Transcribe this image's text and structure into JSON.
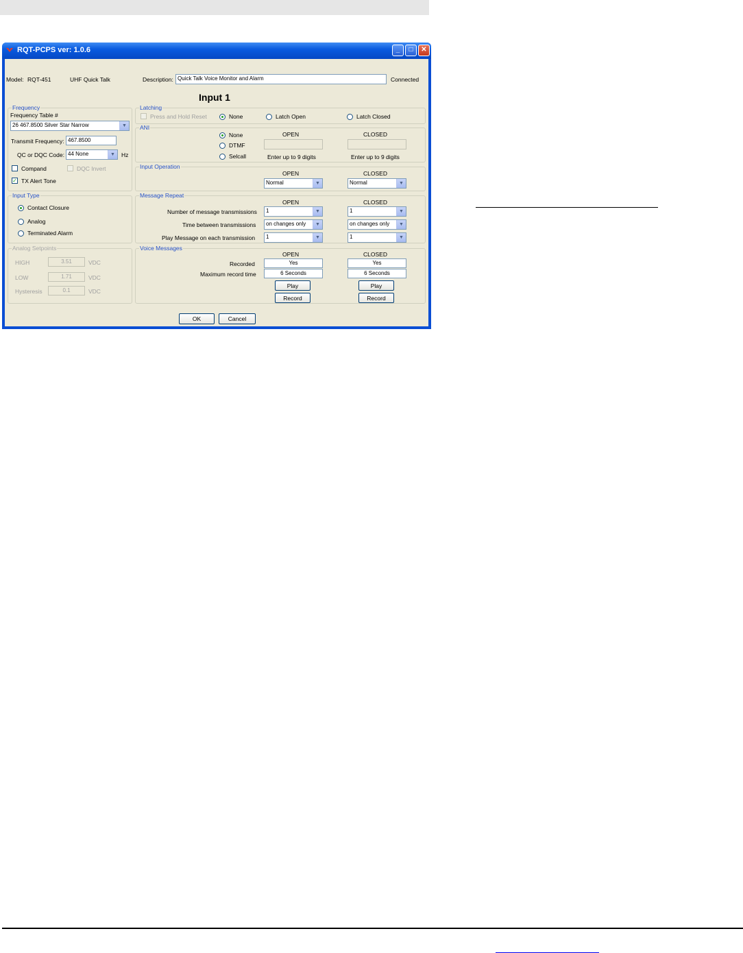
{
  "window": {
    "title": "RQT-PCPS ver: 1.0.6",
    "minimize": "_",
    "maximize": "□",
    "close": "✕"
  },
  "header": {
    "model_label": "Model:",
    "model_value": "RQT-451",
    "product": "UHF Quick Talk",
    "description_label": "Description:",
    "description_value": "Quick Talk Voice Monitor and Alarm",
    "status": "Connected",
    "input_title": "Input  1"
  },
  "frequency": {
    "title": "Frequency",
    "table_label": "Frequency Table #",
    "table_value": "26  467.8500  Silver Star Narrow",
    "tx_label": "Transmit Frequency:",
    "tx_value": "467.8500",
    "qc_label": "QC or DQC Code:",
    "qc_value": "44 None",
    "hz": "Hz",
    "compand": "Compand",
    "dqc_invert": "DQC Invert",
    "tx_alert": "TX Alert Tone"
  },
  "input_type": {
    "title": "Input Type",
    "options": [
      "Contact Closure",
      "Analog",
      "Terminated Alarm"
    ]
  },
  "analog": {
    "title": "Analog Setpoints",
    "high_label": "HIGH",
    "high_value": "3.51",
    "low_label": "LOW",
    "low_value": "1.71",
    "hyst_label": "Hysteresis",
    "hyst_value": "0.1",
    "unit": "VDC"
  },
  "latching": {
    "title": "Latching",
    "press_hold": "Press and Hold Reset",
    "none": "None",
    "latch_open": "Latch Open",
    "latch_closed": "Latch Closed"
  },
  "ani": {
    "title": "ANI",
    "none": "None",
    "dtmf": "DTMF",
    "selcall": "Selcall",
    "open": "OPEN",
    "closed": "CLOSED",
    "hint_open": "Enter up to 9 digits",
    "hint_closed": "Enter up to 9 digits"
  },
  "input_operation": {
    "title": "Input Operation",
    "open": "OPEN",
    "closed": "CLOSED",
    "open_value": "Normal",
    "closed_value": "Normal"
  },
  "message_repeat": {
    "title": "Message Repeat",
    "open": "OPEN",
    "closed": "CLOSED",
    "row1_label": "Number of message transmissions",
    "row1_open": "1",
    "row1_closed": "1",
    "row2_label": "Time between transmissions",
    "row2_open": "on changes only",
    "row2_closed": "on changes only",
    "row3_label": "Play Message on each transmission",
    "row3_open": "1",
    "row3_closed": "1"
  },
  "voice": {
    "title": "Voice Messages",
    "open": "OPEN",
    "closed": "CLOSED",
    "recorded_label": "Recorded",
    "recorded_open": "Yes",
    "recorded_closed": "Yes",
    "max_label": "Maximum record time",
    "max_open": "6 Seconds",
    "max_closed": "6 Seconds",
    "play": "Play",
    "record": "Record"
  },
  "footer": {
    "ok": "OK",
    "cancel": "Cancel"
  }
}
